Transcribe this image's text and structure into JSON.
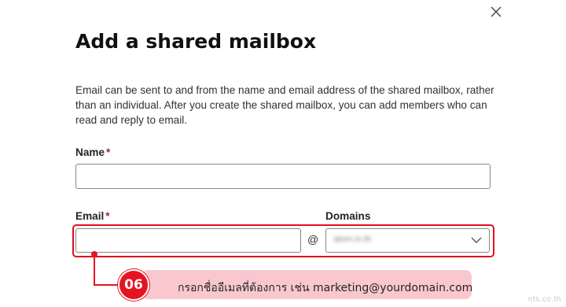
{
  "dialog": {
    "title": "Add a shared mailbox",
    "description": "Email can be sent to and from the name and email address of the shared mailbox, rather than an individual. After you create the shared mailbox, you can add members who can read and reply to email.",
    "close_icon": "close-icon"
  },
  "form": {
    "name_label": "Name",
    "name_value": "",
    "email_label": "Email",
    "email_value": "",
    "required_marker": "*",
    "at_sign": "@",
    "domains_label": "Domains",
    "domains_selected": "atom.in.th",
    "dropdown_icon": "chevron-down-icon"
  },
  "annotation": {
    "step_number": "06",
    "callout_text": "กรอกชื่ออีเมลที่ต้องการ เช่น marketing@yourdomain.com",
    "accent_color": "#e51422",
    "callout_bg": "#f9c8cf"
  },
  "watermark": "nts.co.th"
}
